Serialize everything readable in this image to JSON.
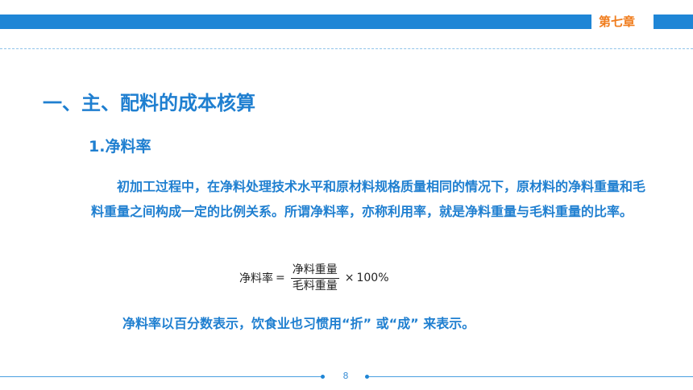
{
  "header": {
    "chapter": "第七章"
  },
  "content": {
    "heading": "一、主、配料的成本核算",
    "subheading": "1.净料率",
    "paragraph": "初加工过程中，在净料处理技术水平和原材料规格质量相同的情况下，原材料的净料重量和毛料重量之间构成一定的比例关系。所谓净料率，亦称利用率，就是净料重量与毛料重量的比率。",
    "formula": {
      "lhs": "净料率",
      "equals": "=",
      "numerator": "净料重量",
      "denominator": "毛料重量",
      "times": "×",
      "factor": "100%"
    },
    "note": "净料率以百分数表示，饮食业也习惯用“折” 或“成” 来表示。"
  },
  "footer": {
    "page_number": "8"
  },
  "colors": {
    "accent": "#1f86d6",
    "chapter": "#f07c1c",
    "text": "#1f7fd0"
  }
}
